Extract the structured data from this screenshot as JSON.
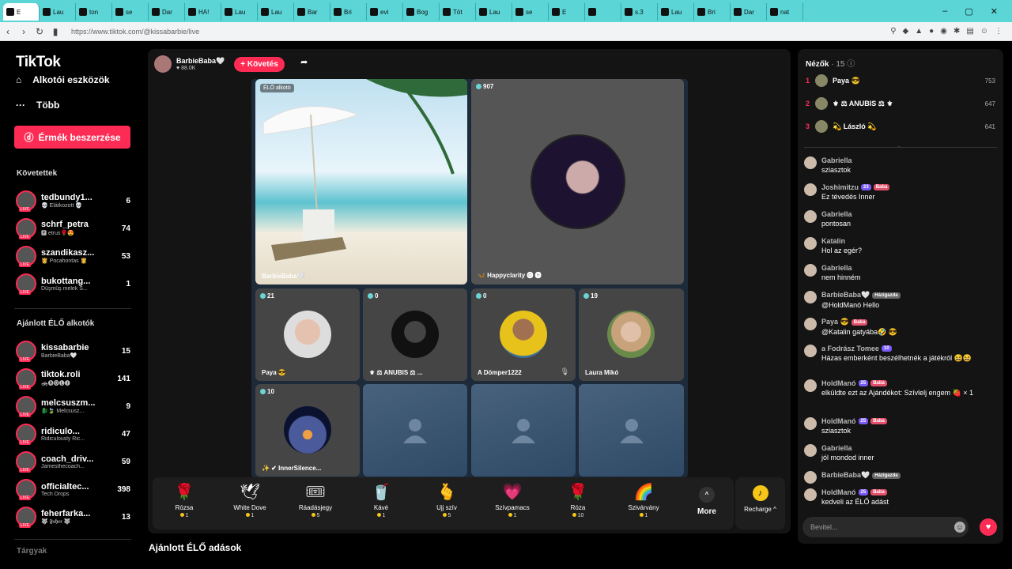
{
  "browser": {
    "tabs": [
      "E",
      "Lau",
      "ton",
      "se",
      "Dar",
      "HA!",
      "Lau",
      "Lau",
      "Bar",
      "Bri",
      "evi",
      "Bog",
      "Töt",
      "Lau",
      "se",
      "E",
      "",
      "s.3",
      "Lau",
      "Bri",
      "Dar",
      "nat"
    ],
    "url": "https://www.tiktok.com/@kissabarbie/live"
  },
  "sidebar": {
    "logo": "TikTok",
    "nav": [
      {
        "label": "Alkotói eszközök"
      },
      {
        "label": "Több"
      }
    ],
    "coins_button": "Érmék beszerzése",
    "following_header": "Követettek",
    "following": [
      {
        "name": "tedbundy1...",
        "sub": "💀 Elátkozott 💀",
        "count": "6"
      },
      {
        "name": "schrf_petra",
        "sub": "🅿 etrus🌹😍",
        "count": "74"
      },
      {
        "name": "szandikasz...",
        "sub": "👸 Pocahontas 👸",
        "count": "53"
      },
      {
        "name": "bukottang...",
        "sub": "Düşmüş melek S...",
        "count": "1"
      }
    ],
    "recommended_header": "Ajánlott ÉLŐ alkotók",
    "recommended": [
      {
        "name": "kissabarbie",
        "sub": "BarbieBaba🤍",
        "count": "15"
      },
      {
        "name": "tiktok.roli",
        "sub": "🚓🅡🅞🅛🅘",
        "count": "141"
      },
      {
        "name": "melcsuszm...",
        "sub": "🐉🍃 Melcsusz...",
        "count": "9"
      },
      {
        "name": "ridiculo...",
        "sub": "Ridiculously Ric...",
        "count": "47"
      },
      {
        "name": "coach_driv...",
        "sub": "Jamesthecoach...",
        "count": "59"
      },
      {
        "name": "officialtec...",
        "sub": "Tech Drops",
        "count": "398"
      },
      {
        "name": "feherfarka...",
        "sub": "🐺 𝕱𝖊𝖍𝖊𝖗 🐺",
        "count": "13"
      }
    ],
    "footer_cut": "Tárgyak"
  },
  "stage": {
    "host_name": "BarbieBaba🤍",
    "host_likes": "♥ 88.0K",
    "follow_label": "+ Követés",
    "main_badge": "ÉLŐ alkotó",
    "main_name": "BarbieBaba🤍",
    "guest_main": {
      "count": "907",
      "name": "🦋 Happyclarity 🅞 🅗"
    },
    "cells": [
      {
        "count": "21",
        "name": "Paya 😎"
      },
      {
        "count": "0",
        "name": "⚜ ⚖ ANUBIS ⚖ ..."
      },
      {
        "count": "0",
        "name": "A Dömper1222"
      },
      {
        "count": "19",
        "name": "Laura Mikó"
      },
      {
        "count": "10",
        "name": "✨ ✔ InnerSilence..."
      }
    ],
    "gifts": [
      {
        "name": "Rózsa",
        "price": "1",
        "icon": "🌹"
      },
      {
        "name": "White Dove",
        "price": "1",
        "icon": "🕊"
      },
      {
        "name": "Ráadásjegy",
        "price": "5",
        "icon": "🎟"
      },
      {
        "name": "Kávé",
        "price": "1",
        "icon": "🥤"
      },
      {
        "name": "Ujj szív",
        "price": "5",
        "icon": "🫰"
      },
      {
        "name": "Szívpamacs",
        "price": "1",
        "icon": "💗"
      },
      {
        "name": "Róza",
        "price": "10",
        "icon": "🌹"
      },
      {
        "name": "Szivárvány",
        "price": "1",
        "icon": "🌈"
      }
    ],
    "more_label": "More",
    "recharge_label": "Recharge ^"
  },
  "below_title": "Ajánlott ÉLŐ adások",
  "chat": {
    "viewers_label": "Nézők",
    "viewers_count": "· 15",
    "top_viewers": [
      {
        "rank": "1",
        "name": "Paya 😎",
        "score": "753"
      },
      {
        "rank": "2",
        "name": "⚜ ⚖ ANUBIS ⚖ ⚜",
        "score": "647"
      },
      {
        "rank": "3",
        "name": "💫 László 💫",
        "score": "641"
      }
    ],
    "messages": [
      {
        "user": "Gabriella",
        "badges": [],
        "text": "sziasztok"
      },
      {
        "user": "Joshimitzu",
        "badges": [
          "23",
          "Baba"
        ],
        "text": "Ez tévedés Inner"
      },
      {
        "user": "Gabriella",
        "badges": [],
        "text": "pontosan"
      },
      {
        "user": "Katalin",
        "badges": [],
        "text": "Hol az egér?"
      },
      {
        "user": "Gabriella",
        "badges": [],
        "text": "nem hinném"
      },
      {
        "user": "BarbieBaba🤍",
        "badges": [
          "Házigazda"
        ],
        "text": "@HoldManó Hello"
      },
      {
        "user": "Paya 😎",
        "badges": [
          "Baba"
        ],
        "text": "@Katalin gatyába🤣 😎"
      },
      {
        "user": "a Fodrász Tomee",
        "badges": [
          "10"
        ],
        "text": "Házas emberként beszélhetnék a játékról 😆😆"
      },
      {
        "user": "HoldManó",
        "badges": [
          "25",
          "Baba"
        ],
        "text": "elküldte ezt az Ajándékot: Szívlelj engem 🍓 × 1"
      },
      {
        "user": "HoldManó",
        "badges": [
          "25",
          "Baba"
        ],
        "text": "sziasztok"
      },
      {
        "user": "Gabriella",
        "badges": [],
        "text": "jól mondod inner"
      },
      {
        "user": "BarbieBaba🤍",
        "badges": [
          "Házigazda"
        ],
        "text": ""
      },
      {
        "user": "HoldManó",
        "badges": [
          "25",
          "Baba"
        ],
        "text": "kedveli az ÉLŐ adást"
      }
    ],
    "input_placeholder": "Bevitel..."
  }
}
